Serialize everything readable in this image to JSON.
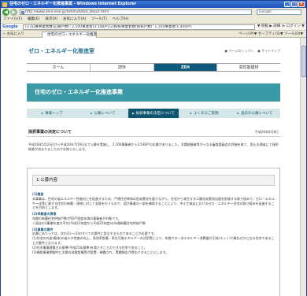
{
  "window": {
    "title": "住宅のゼロ・エネルギー化推進事業 - Windows Internet Explorer",
    "min": "_",
    "max": "□",
    "close": "×"
  },
  "address": {
    "url": "http://www.zero-ene.jp/zeh/h26/bid_about.html",
    "search_placeholder": "Google"
  },
  "menu": [
    "ファイル(F)",
    "編集(E)",
    "表示(V)",
    "お気に入り(A)",
    "ツール(T)",
    "ヘルプ(H)"
  ],
  "googlebar": {
    "logo": "Google",
    "query": "(3.)公募事業者数(応募戸数): 2,100事業者(3,548戸)(2)採択事業者数(採択戸数): 1,104事業者(1,400戸)",
    "tools": "▼ 移動 ▶ 詳細 ≫ ログイン ▼"
  },
  "tabs": {
    "favorites": "☆ お気に入り",
    "active": "住宅のゼロ・エネルギー化推進事業",
    "tools": "ページ(P)▼ セーフティ(S)▼ ツール(O)▼"
  },
  "site": {
    "title": "ゼロ・エネルギー化推進室",
    "util_links": [
      "● ページのトップへ",
      "● サイトマップ"
    ],
    "globalnav": [
      {
        "label": "ホーム",
        "active": false
      },
      {
        "label": "ZEB",
        "active": false
      },
      {
        "label": "ZEH",
        "active": true
      },
      {
        "label": "高性能建材",
        "active": false
      }
    ],
    "banner": "住宅のゼロ・エネルギー化推進事業",
    "subnav": [
      {
        "label": "事業トップ",
        "active": false
      },
      {
        "label": "公募について",
        "active": false
      },
      {
        "label": "採択事業の決定について",
        "active": true
      },
      {
        "label": "よくあるご質問",
        "active": false
      },
      {
        "label": "過去の公募について",
        "active": false
      }
    ],
    "page_title": "採択事業の決定について",
    "page_date": "平成26年8月8日",
    "intro": "平成26年5月23日から平成26年7月9日まで公募を実施し、2,100事業者から3,548戸の応募がありました。学識経験者等からなる審査委員会の評価を経て、国土交通省にて採択結果が決まりましたのでお知らせします。",
    "section_title": "1.公募内容",
    "body": [
      {
        "type": "h",
        "text": "(1)趣旨"
      },
      {
        "type": "p",
        "text": "本事業は、住宅の省エネルギー性能向上を促進するため、戸建住宅単体の低炭素化を図りながら、住宅から発生する二酸化炭素排出量を削減する取り組みで、ゼロ・エネルギー化等に資する住宅の新築・改修に対して支援を行うもので、国が事業の一部を補助することにより、中小工務店におけるゼロ・エネルギー住宅の取り組みを促進することを目的とします。"
      },
      {
        "type": "h",
        "text": "(2)申請者の資格"
      },
      {
        "type": "p",
        "text": "年間の新築住宅供給戸数が50戸程度未満の事業者が対象です。"
      },
      {
        "type": "p",
        "text": "＋過去の3事業年度の平均(平成23年度から平成25年度)の年間新築住宅供給戸数"
      },
      {
        "type": "h",
        "text": "(3)事業の要件"
      },
      {
        "type": "p",
        "text": "応募にあたっては、次の(1)〜(3)のすべての要件に該当するものであることが必要です。"
      },
      {
        "type": "p",
        "text": "(1)住宅の外皮(躯体)の省エネ性能の向上、高効率設備・再生可能エネルギーの活用等により、年間での一次エネルギー消費量が正味(ネット)で概ねゼロとなる住宅であることが要件となります。"
      },
      {
        "type": "p",
        "text": "(2)住宅事業建築主の基準(平成25年基準)を満たすことのできる住宅であること。"
      },
      {
        "type": "p",
        "text": "(3)補助事業期間中に太陽光発電設備等が設置・稼働され、実績報告が提出できることとします。"
      }
    ]
  }
}
